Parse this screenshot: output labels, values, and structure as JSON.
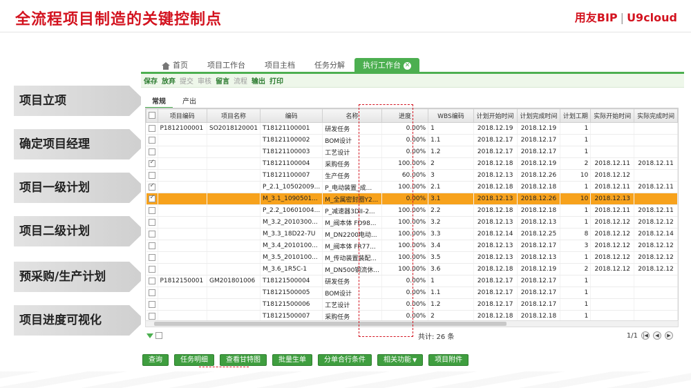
{
  "slide": {
    "title": "全流程项目制造的关键控制点",
    "brand_left": "用友BIP",
    "brand_right": "U9cloud"
  },
  "steps": [
    "项目立项",
    "确定项目经理",
    "项目一级计划",
    "项目二级计划",
    "预采购/生产计划",
    "项目进度可视化"
  ],
  "nav": {
    "tabs": [
      "首页",
      "项目工作台",
      "项目主档",
      "任务分解",
      "执行工作台"
    ],
    "active": "执行工作台"
  },
  "toolbar": {
    "items": [
      "保存",
      "放弃",
      "提交",
      "审核",
      "留言",
      "流程",
      "输出",
      "打印"
    ]
  },
  "subtabs": [
    "常规",
    "产出"
  ],
  "grid": {
    "columns": [
      "",
      "项目编码",
      "项目名称",
      "编码",
      "名称",
      "进度",
      "WBS编码",
      "计划开始时间",
      "计划完成时间",
      "计划工期",
      "实际开始时间",
      "实际完成时间"
    ],
    "rows": [
      {
        "checked": false,
        "proj": "P1812100001",
        "pname": "SO2018120001",
        "code": "T18121100001",
        "name": "研发任务",
        "prog": "0.00%",
        "wbs": "1",
        "ps": "2018.12.19",
        "pe": "2018.12.19",
        "dur": "1",
        "as": "",
        "ae": "",
        "hl": false
      },
      {
        "checked": false,
        "proj": "",
        "pname": "",
        "code": "T18121100002",
        "name": "BOM设计",
        "prog": "0.00%",
        "wbs": "1.1",
        "ps": "2018.12.17",
        "pe": "2018.12.17",
        "dur": "1",
        "as": "",
        "ae": "",
        "hl": false
      },
      {
        "checked": false,
        "proj": "",
        "pname": "",
        "code": "T18121100003",
        "name": "工艺设计",
        "prog": "0.00%",
        "wbs": "1.2",
        "ps": "2018.12.17",
        "pe": "2018.12.17",
        "dur": "1",
        "as": "",
        "ae": "",
        "hl": false
      },
      {
        "checked": true,
        "proj": "",
        "pname": "",
        "code": "T18121100004",
        "name": "采购任务",
        "prog": "100.00%",
        "wbs": "2",
        "ps": "2018.12.18",
        "pe": "2018.12.19",
        "dur": "2",
        "as": "2018.12.11",
        "ae": "2018.12.11",
        "hl": false
      },
      {
        "checked": false,
        "proj": "",
        "pname": "",
        "code": "T18121100007",
        "name": "生产任务",
        "prog": "60.00%",
        "wbs": "3",
        "ps": "2018.12.13",
        "pe": "2018.12.26",
        "dur": "10",
        "as": "2018.12.12",
        "ae": "",
        "hl": false
      },
      {
        "checked": true,
        "proj": "",
        "pname": "",
        "code": "P_2.1_10502009...",
        "name": "P_电动装置_成...",
        "prog": "100.00%",
        "wbs": "2.1",
        "ps": "2018.12.18",
        "pe": "2018.12.18",
        "dur": "1",
        "as": "2018.12.11",
        "ae": "2018.12.11",
        "hl": false
      },
      {
        "checked": true,
        "proj": "",
        "pname": "",
        "code": "M_3.1_1090501...",
        "name": "M_全属密封圈Y2...",
        "prog": "0.00%",
        "wbs": "3.1",
        "ps": "2018.12.13",
        "pe": "2018.12.26",
        "dur": "10",
        "as": "2018.12.13",
        "ae": "",
        "hl": true
      },
      {
        "checked": false,
        "proj": "",
        "pname": "",
        "code": "P_2.2_10601004...",
        "name": "P_减速器3DII-2...",
        "prog": "100.00%",
        "wbs": "2.2",
        "ps": "2018.12.18",
        "pe": "2018.12.18",
        "dur": "1",
        "as": "2018.12.11",
        "ae": "2018.12.11",
        "hl": false
      },
      {
        "checked": false,
        "proj": "",
        "pname": "",
        "code": "M_3.2_2010300...",
        "name": "M_阀本体 FD98...",
        "prog": "100.00%",
        "wbs": "3.2",
        "ps": "2018.12.13",
        "pe": "2018.12.13",
        "dur": "1",
        "as": "2018.12.12",
        "ae": "2018.12.12",
        "hl": false
      },
      {
        "checked": false,
        "proj": "",
        "pname": "",
        "code": "M_3.3_18D22-7U",
        "name": "M_DN2200电动...",
        "prog": "100.00%",
        "wbs": "3.3",
        "ps": "2018.12.14",
        "pe": "2018.12.25",
        "dur": "8",
        "as": "2018.12.12",
        "ae": "2018.12.14",
        "hl": false
      },
      {
        "checked": false,
        "proj": "",
        "pname": "",
        "code": "M_3.4_2010100...",
        "name": "M_阀本体 FR77...",
        "prog": "100.00%",
        "wbs": "3.4",
        "ps": "2018.12.13",
        "pe": "2018.12.17",
        "dur": "3",
        "as": "2018.12.12",
        "ae": "2018.12.12",
        "hl": false
      },
      {
        "checked": false,
        "proj": "",
        "pname": "",
        "code": "M_3.5_2010100...",
        "name": "M_传动装置装配...",
        "prog": "100.00%",
        "wbs": "3.5",
        "ps": "2018.12.13",
        "pe": "2018.12.13",
        "dur": "1",
        "as": "2018.12.12",
        "ae": "2018.12.12",
        "hl": false
      },
      {
        "checked": false,
        "proj": "",
        "pname": "",
        "code": "M_3.6_1R5C-1",
        "name": "M_DN500钢流休...",
        "prog": "100.00%",
        "wbs": "3.6",
        "ps": "2018.12.18",
        "pe": "2018.12.19",
        "dur": "2",
        "as": "2018.12.12",
        "ae": "2018.12.12",
        "hl": false
      },
      {
        "checked": false,
        "proj": "P1812150001",
        "pname": "GM201801006",
        "code": "T18121500004",
        "name": "研发任务",
        "prog": "0.00%",
        "wbs": "1",
        "ps": "2018.12.17",
        "pe": "2018.12.17",
        "dur": "1",
        "as": "",
        "ae": "",
        "hl": false
      },
      {
        "checked": false,
        "proj": "",
        "pname": "",
        "code": "T18121500005",
        "name": "BOM设计",
        "prog": "0.00%",
        "wbs": "1.1",
        "ps": "2018.12.17",
        "pe": "2018.12.17",
        "dur": "1",
        "as": "",
        "ae": "",
        "hl": false
      },
      {
        "checked": false,
        "proj": "",
        "pname": "",
        "code": "T18121500006",
        "name": "工艺设计",
        "prog": "0.00%",
        "wbs": "1.2",
        "ps": "2018.12.17",
        "pe": "2018.12.17",
        "dur": "1",
        "as": "",
        "ae": "",
        "hl": false
      },
      {
        "checked": false,
        "proj": "",
        "pname": "",
        "code": "T18121500007",
        "name": "采购任务",
        "prog": "0.00%",
        "wbs": "2",
        "ps": "2018.12.18",
        "pe": "2018.12.18",
        "dur": "1",
        "as": "",
        "ae": "",
        "hl": false
      }
    ]
  },
  "footer": {
    "total": "共计: 26 条",
    "page": "1/1"
  },
  "buttons": [
    "查询",
    "任务明细",
    "查看甘特图",
    "批量生单",
    "分单合行条件",
    "相关功能",
    "项目附件"
  ]
}
